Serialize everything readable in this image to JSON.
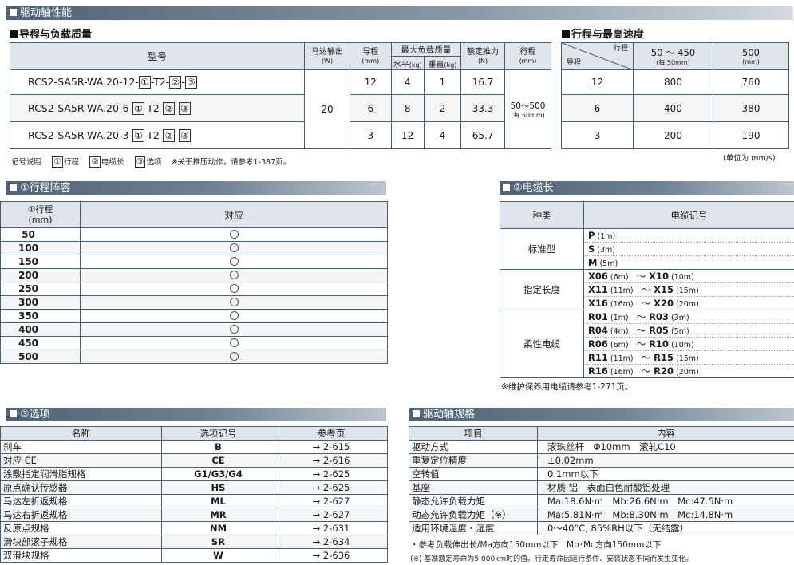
{
  "sec_drive_perf": "驱动轴性能",
  "lead_load": {
    "title": "导程与负载质量",
    "h_model": "型号",
    "h_motor": "马达输出",
    "h_motor_u": "(W)",
    "h_lead": "导程",
    "h_lead_u": "(mm)",
    "h_maxload": "最大负载质量",
    "h_horiz": "水平",
    "h_horiz_u": "(kg)",
    "h_vert": "垂直",
    "h_vert_u": "(kg)",
    "h_thrust": "额定推力",
    "h_thrust_u": "(N)",
    "h_stroke": "行程",
    "h_stroke_u": "(mm)",
    "motor_val": "20",
    "stroke_val": "50～500",
    "stroke_sub": "(每 50mm)",
    "rows": [
      {
        "model": "RCS2-SA5R-WA.20-12-",
        "opt1": "①",
        "mid": "-T2-",
        "opt2": "②",
        "dash": "-",
        "opt3": "③",
        "lead": "12",
        "h": "4",
        "v": "1",
        "f": "16.7"
      },
      {
        "model": "RCS2-SA5R-WA.20-6-",
        "opt1": "①",
        "mid": "-T2-",
        "opt2": "②",
        "dash": "-",
        "opt3": "③",
        "lead": "6",
        "h": "8",
        "v": "2",
        "f": "33.3"
      },
      {
        "model": "RCS2-SA5R-WA.20-3-",
        "opt1": "①",
        "mid": "-T2-",
        "opt2": "②",
        "dash": "-",
        "opt3": "③",
        "lead": "3",
        "h": "12",
        "v": "4",
        "f": "65.7"
      }
    ]
  },
  "legend": {
    "label": "记号说明",
    "k1": "①",
    "t1": "行程",
    "k2": "②",
    "t2": "电缆长",
    "k3": "③",
    "t3": "选项",
    "note": "※关于推压动作，请参考1-387页。"
  },
  "speed": {
    "title": "行程与最高速度",
    "corner_top": "行程",
    "corner_bottom": "导程",
    "c1": "50 ～ 450",
    "c1_sub": "(每 50mm)",
    "c2": "500",
    "c2_sub": "(mm)",
    "rows": [
      {
        "lead": "12",
        "a": "800",
        "b": "760"
      },
      {
        "lead": "6",
        "a": "400",
        "b": "380"
      },
      {
        "lead": "3",
        "a": "200",
        "b": "190"
      }
    ],
    "unit": "(单位为 mm/s)"
  },
  "stroke_list": {
    "title": "①行程阵容",
    "h1": "①行程",
    "h1_u": "(mm)",
    "h2": "对应",
    "rows": [
      "50",
      "100",
      "150",
      "200",
      "250",
      "300",
      "350",
      "400",
      "450",
      "500"
    ]
  },
  "cable": {
    "title": "②电缆长",
    "h1": "种类",
    "h2": "电缆记号",
    "groups": [
      {
        "type": "标准型",
        "items": [
          {
            "a": "P",
            "al": "(1m)"
          },
          {
            "a": "S",
            "al": "(3m)"
          },
          {
            "a": "M",
            "al": "(5m)"
          }
        ]
      },
      {
        "type": "指定长度",
        "items": [
          {
            "a": "X06",
            "al": "(6m)",
            "t": "～",
            "b": "X10",
            "bl": "(10m)"
          },
          {
            "a": "X11",
            "al": "(11m)",
            "t": "～",
            "b": "X15",
            "bl": "(15m)"
          },
          {
            "a": "X16",
            "al": "(16m)",
            "t": "～",
            "b": "X20",
            "bl": "(20m)"
          }
        ]
      },
      {
        "type": "柔性电缆",
        "items": [
          {
            "a": "R01",
            "al": "(1m)",
            "t": "～",
            "b": "R03",
            "bl": "(3m)"
          },
          {
            "a": "R04",
            "al": "(4m)",
            "t": "～",
            "b": "R05",
            "bl": "(5m)"
          },
          {
            "a": "R06",
            "al": "(6m)",
            "t": "～",
            "b": "R10",
            "bl": "(10m)"
          },
          {
            "a": "R11",
            "al": "(11m)",
            "t": "～",
            "b": "R15",
            "bl": "(15m)"
          },
          {
            "a": "R16",
            "al": "(16m)",
            "t": "～",
            "b": "R20",
            "bl": "(20m)"
          }
        ]
      }
    ],
    "note": "※维护保养用电缆请参考1-271页。"
  },
  "options": {
    "title": "③选项",
    "h1": "名称",
    "h2": "选项记号",
    "h3": "参考页",
    "rows": [
      {
        "n": "刹车",
        "c": "B",
        "p": "→ 2-615"
      },
      {
        "n": "对应 CE",
        "c": "CE",
        "p": "→ 2-616"
      },
      {
        "n": "涂敷指定润滑脂规格",
        "c": "G1/G3/G4",
        "p": "→ 2-625"
      },
      {
        "n": "原点确认传感器",
        "c": "HS",
        "p": "→ 2-625"
      },
      {
        "n": "马达左折返规格",
        "c": "ML",
        "p": "→ 2-627"
      },
      {
        "n": "马达右折返规格",
        "c": "MR",
        "p": "→ 2-627"
      },
      {
        "n": "反原点规格",
        "c": "NM",
        "p": "→ 2-631"
      },
      {
        "n": "滑块部滚子规格",
        "c": "SR",
        "p": "→ 2-634"
      },
      {
        "n": "双滑块规格",
        "c": "W",
        "p": "→ 2-636"
      }
    ]
  },
  "spec": {
    "title": "驱动轴规格",
    "h1": "项目",
    "h2": "内容",
    "rows": [
      {
        "k": "驱动方式",
        "v": "滚珠丝杆　Φ10mm　滚轧C10"
      },
      {
        "k": "重复定位精度",
        "v": "±0.02mm"
      },
      {
        "k": "空转值",
        "v": "0.1mm以下"
      },
      {
        "k": "基座",
        "v": "材质 铝　表面白色耐酸铝处理"
      },
      {
        "k": "静态允许负载力矩",
        "v": "Ma:18.6N·m　Mb:26.6N·m　Mc:47.5N·m"
      },
      {
        "k": "动态允许负载力矩（※）",
        "v": "Ma:5.81N·m　Mb:8.30N·m　Mc:14.8N·m"
      },
      {
        "k": "适用环境温度・湿度",
        "v": "0～40°C, 85%RH以下（无结露）"
      }
    ],
    "note1": "・参考负载伸出长/Ma方向150mm以下　Mb･Mc方向150mm以下",
    "note2": "(※) 基准额定寿命为5,000km时的值。行走寿命因运行条件、安装状态不同而发生变化。"
  }
}
